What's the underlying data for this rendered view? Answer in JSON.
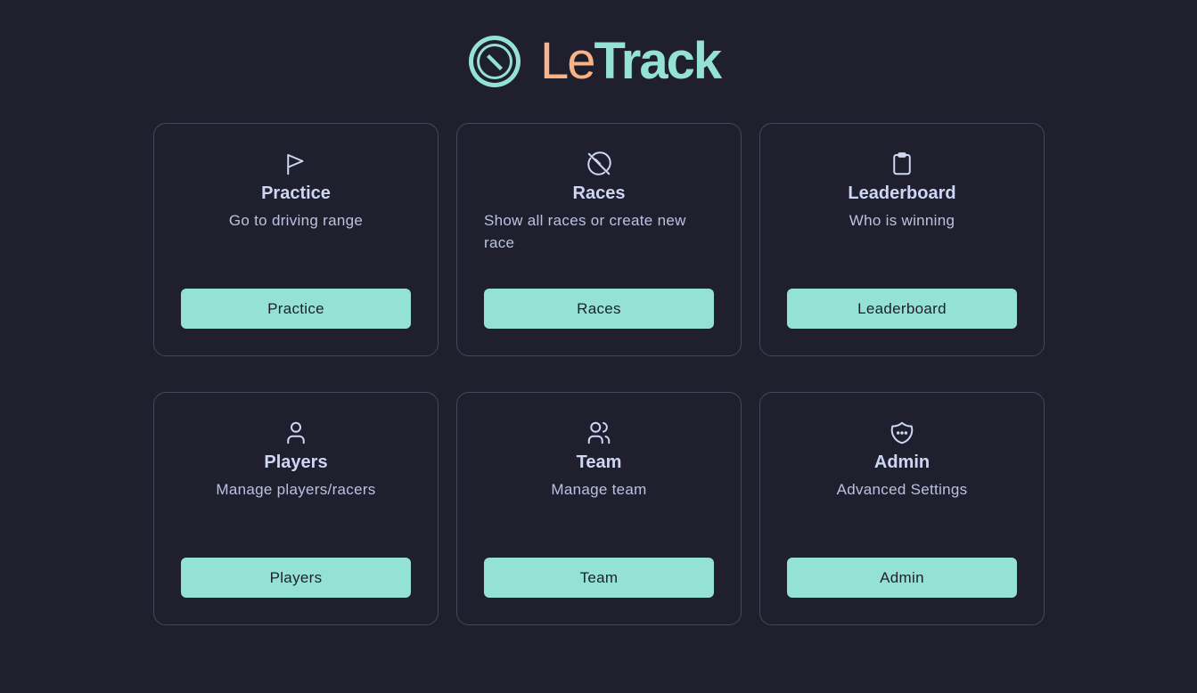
{
  "brand": {
    "name_part1": "Le",
    "name_part2": "Track",
    "colors": {
      "part1": "#fab387",
      "part2": "#94e2d5",
      "mark": "#94e2d5"
    }
  },
  "theme": {
    "background": "#1f1f2e",
    "card_border": "#45475a",
    "button_bg": "#94e2d5",
    "button_text": "#1e1e2e"
  },
  "cards": [
    {
      "icon": "flag-icon",
      "title": "Practice",
      "description": "Go to driving range",
      "button": "Practice"
    },
    {
      "icon": "gauge-off-icon",
      "title": "Races",
      "description": "Show all races or create new race",
      "button": "Races"
    },
    {
      "icon": "clipboard-icon",
      "title": "Leaderboard",
      "description": "Who is winning",
      "button": "Leaderboard"
    },
    {
      "icon": "user-icon",
      "title": "Players",
      "description": "Manage players/racers",
      "button": "Players"
    },
    {
      "icon": "users-icon",
      "title": "Team",
      "description": "Manage team",
      "button": "Team"
    },
    {
      "icon": "shield-dots-icon",
      "title": "Admin",
      "description": "Advanced Settings",
      "button": "Admin"
    }
  ]
}
